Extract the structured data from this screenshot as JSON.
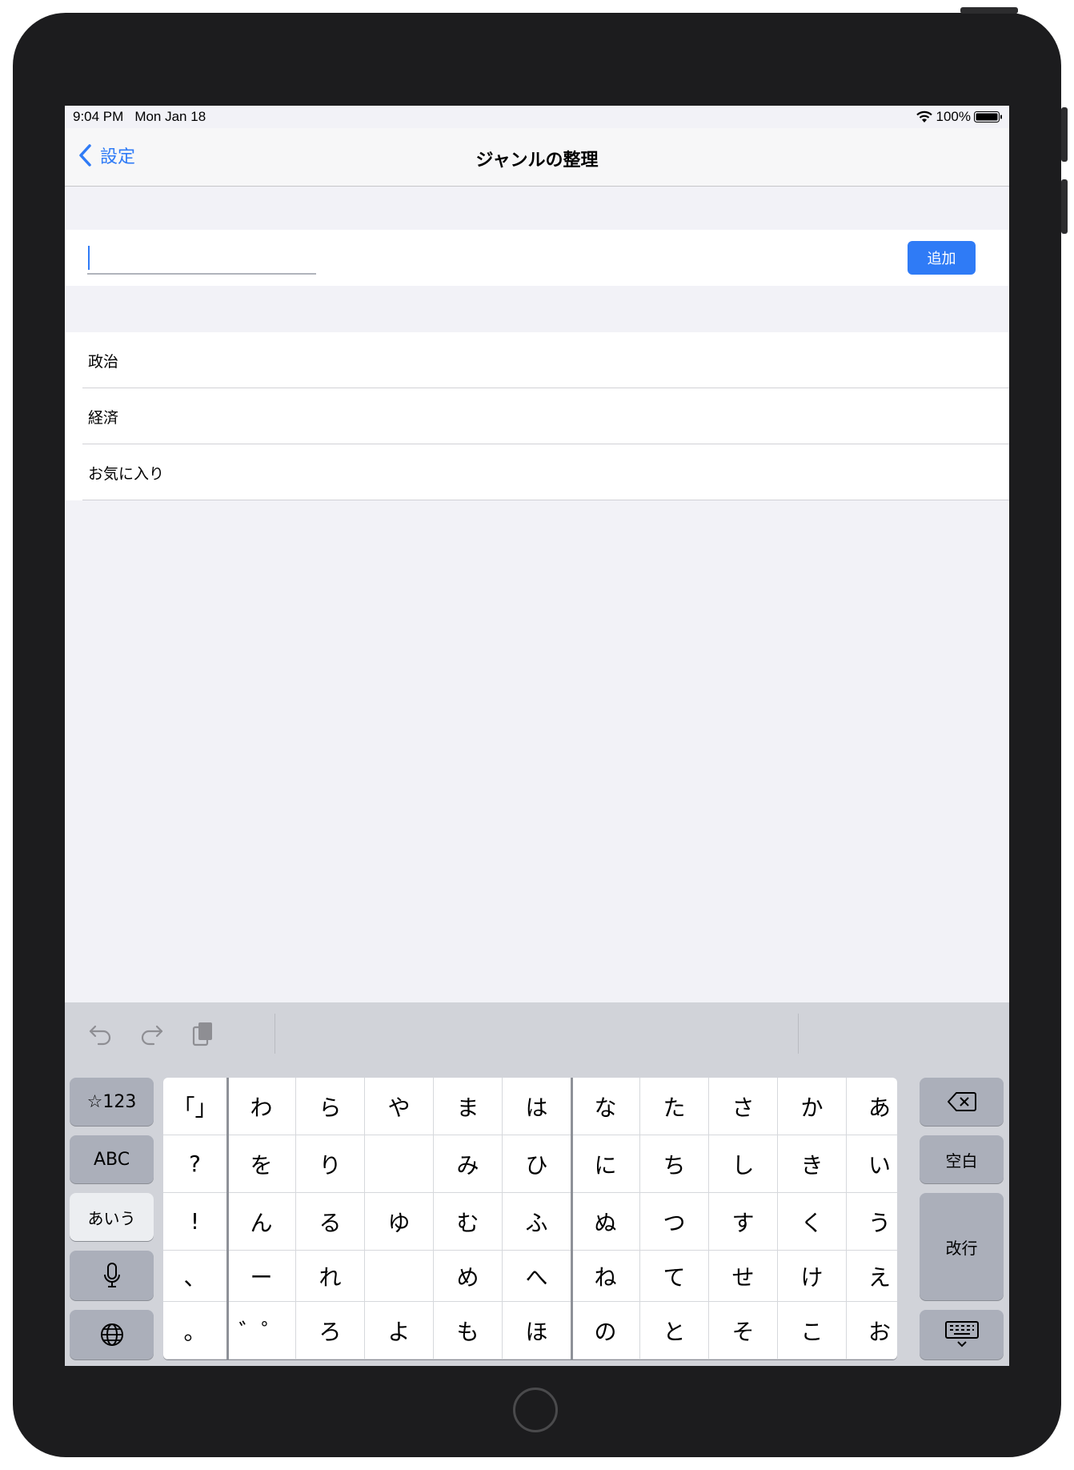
{
  "status_bar": {
    "time": "9:04 PM",
    "date": "Mon Jan 18",
    "battery": "100%"
  },
  "nav": {
    "back_label": "設定",
    "title": "ジャンルの整理"
  },
  "input_row": {
    "value": "",
    "add_label": "追加"
  },
  "genres": [
    "政治",
    "経済",
    "お気に入り"
  ],
  "keyboard": {
    "left_keys": [
      "☆123",
      "ABC",
      "あいう"
    ],
    "right_keys": {
      "space": "空白",
      "return": "改行"
    },
    "kana_rows": [
      [
        "「」",
        "わ",
        "ら",
        "や",
        "ま",
        "は",
        "な",
        "た",
        "さ",
        "か",
        "あ"
      ],
      [
        "?",
        "を",
        "り",
        "",
        "み",
        "ひ",
        "に",
        "ち",
        "し",
        "き",
        "い"
      ],
      [
        "!",
        "ん",
        "る",
        "ゆ",
        "む",
        "ふ",
        "ぬ",
        "つ",
        "す",
        "く",
        "う"
      ],
      [
        "、",
        "ー",
        "れ",
        "",
        "め",
        "へ",
        "ね",
        "て",
        "せ",
        "け",
        "え"
      ],
      [
        "。",
        "゛゜",
        "ろ",
        "よ",
        "も",
        "ほ",
        "の",
        "と",
        "そ",
        "こ",
        "お"
      ]
    ],
    "icons": {
      "undo": "undo-icon",
      "redo": "redo-icon",
      "paste": "paste-icon",
      "delete": "delete-icon",
      "mic": "microphone-icon",
      "globe": "globe-icon",
      "dismiss": "keyboard-dismiss-icon"
    }
  },
  "colors": {
    "accent": "#2f7bf6",
    "background": "#f2f2f7",
    "keyboard": "#d1d3d9"
  }
}
